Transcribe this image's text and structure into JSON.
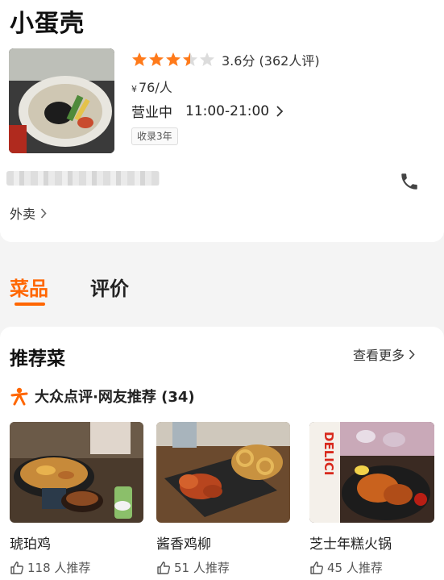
{
  "shop": {
    "name": "小蛋壳",
    "rating": 3.6,
    "score_text": "3.6分 (362人评)",
    "price_symbol": "¥",
    "price": "76/人",
    "status": "营业中",
    "hours": "11:00-21:00",
    "badge": "收录3年",
    "takeout": "外卖"
  },
  "tabs": [
    {
      "label": "菜品"
    },
    {
      "label": "评价"
    }
  ],
  "recommend": {
    "title": "推荐菜",
    "see_more": "查看更多",
    "source": "大众点评·网友推荐 (34)",
    "dishes": [
      {
        "name": "琥珀鸡",
        "likes": "118 人推荐"
      },
      {
        "name": "酱香鸡柳",
        "likes": "51 人推荐"
      },
      {
        "name": "芝士年糕火锅",
        "likes": "45 人推荐"
      }
    ]
  },
  "colors": {
    "accent": "#ff6600",
    "star": "#ff7a1a",
    "star_empty": "#dcdcdc"
  },
  "icons": {
    "phone": "phone-icon",
    "chevron": "chevron-right-icon",
    "thumb": "thumbs-up-icon"
  }
}
